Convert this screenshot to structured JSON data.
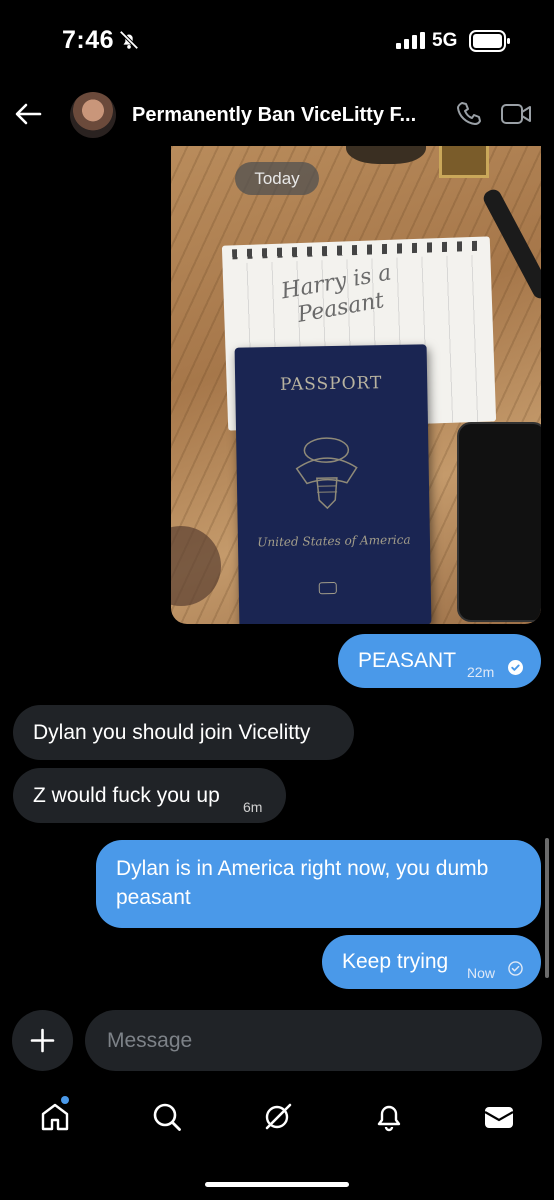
{
  "status_bar": {
    "time": "7:46",
    "network": "5G",
    "icons": [
      "bell-slash-icon",
      "signal-icon",
      "battery-icon"
    ]
  },
  "header": {
    "title": "Permanently Ban ViceLitty F...",
    "icons": [
      "back-arrow-icon",
      "avatar",
      "phone-icon",
      "video-icon"
    ]
  },
  "photo": {
    "date_chip": "Today",
    "notepad_text": "Harry is a Peasant",
    "passport_title": "PASSPORT",
    "passport_country": "United States of America"
  },
  "messages": [
    {
      "direction": "outgoing",
      "text": "PEASANT",
      "time": "22m",
      "read": true
    },
    {
      "direction": "incoming",
      "text": "Dylan you should join Vicelitty",
      "time": ""
    },
    {
      "direction": "incoming",
      "text": "Z would fuck you up",
      "time": "6m"
    },
    {
      "direction": "outgoing",
      "text": "Dylan is in America right now, you dumb peasant",
      "time": ""
    },
    {
      "direction": "outgoing",
      "text": "Keep trying",
      "time": "Now",
      "read": false
    }
  ],
  "composer": {
    "placeholder": "Message",
    "add_icon": "plus-icon"
  },
  "bottom_nav": {
    "items": [
      "home-icon",
      "search-icon",
      "grok-icon",
      "notifications-icon",
      "messages-icon"
    ],
    "home_has_dot": true
  },
  "colors": {
    "outgoing_bubble": "#4a99e9",
    "incoming_bubble": "#202327",
    "background": "#000000"
  }
}
